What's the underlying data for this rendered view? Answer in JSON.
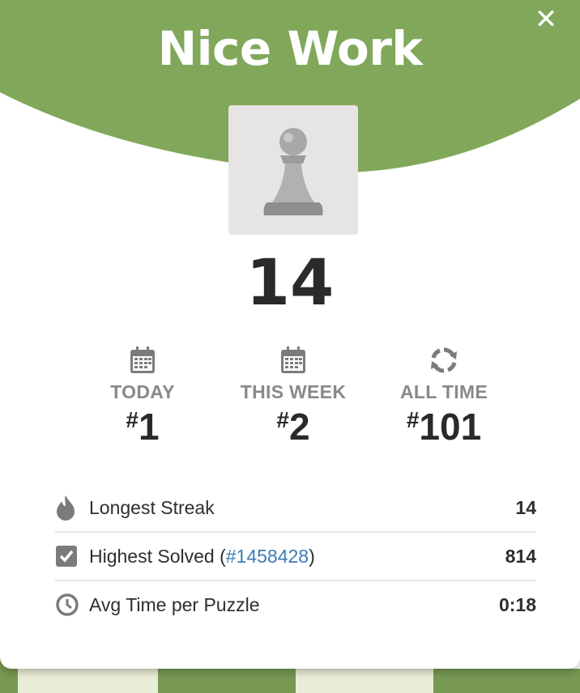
{
  "modal": {
    "title": "Nice Work",
    "close_symbol": "✕",
    "score": "14",
    "hero_color": "#81a85a"
  },
  "ranks": [
    {
      "icon": "calendar-icon",
      "label": "TODAY",
      "hash": "#",
      "value": "1"
    },
    {
      "icon": "calendar-icon",
      "label": "THIS WEEK",
      "hash": "#",
      "value": "2"
    },
    {
      "icon": "refresh-icon",
      "label": "ALL TIME",
      "hash": "#",
      "value": "101"
    }
  ],
  "stats": {
    "longest_streak": {
      "label": "Longest Streak",
      "value": "14"
    },
    "highest_solved": {
      "label_prefix": "Highest Solved (",
      "link": "#1458428",
      "label_suffix": ")",
      "value": "814"
    },
    "avg_time": {
      "label": "Avg Time per Puzzle",
      "value": "0:18"
    }
  }
}
